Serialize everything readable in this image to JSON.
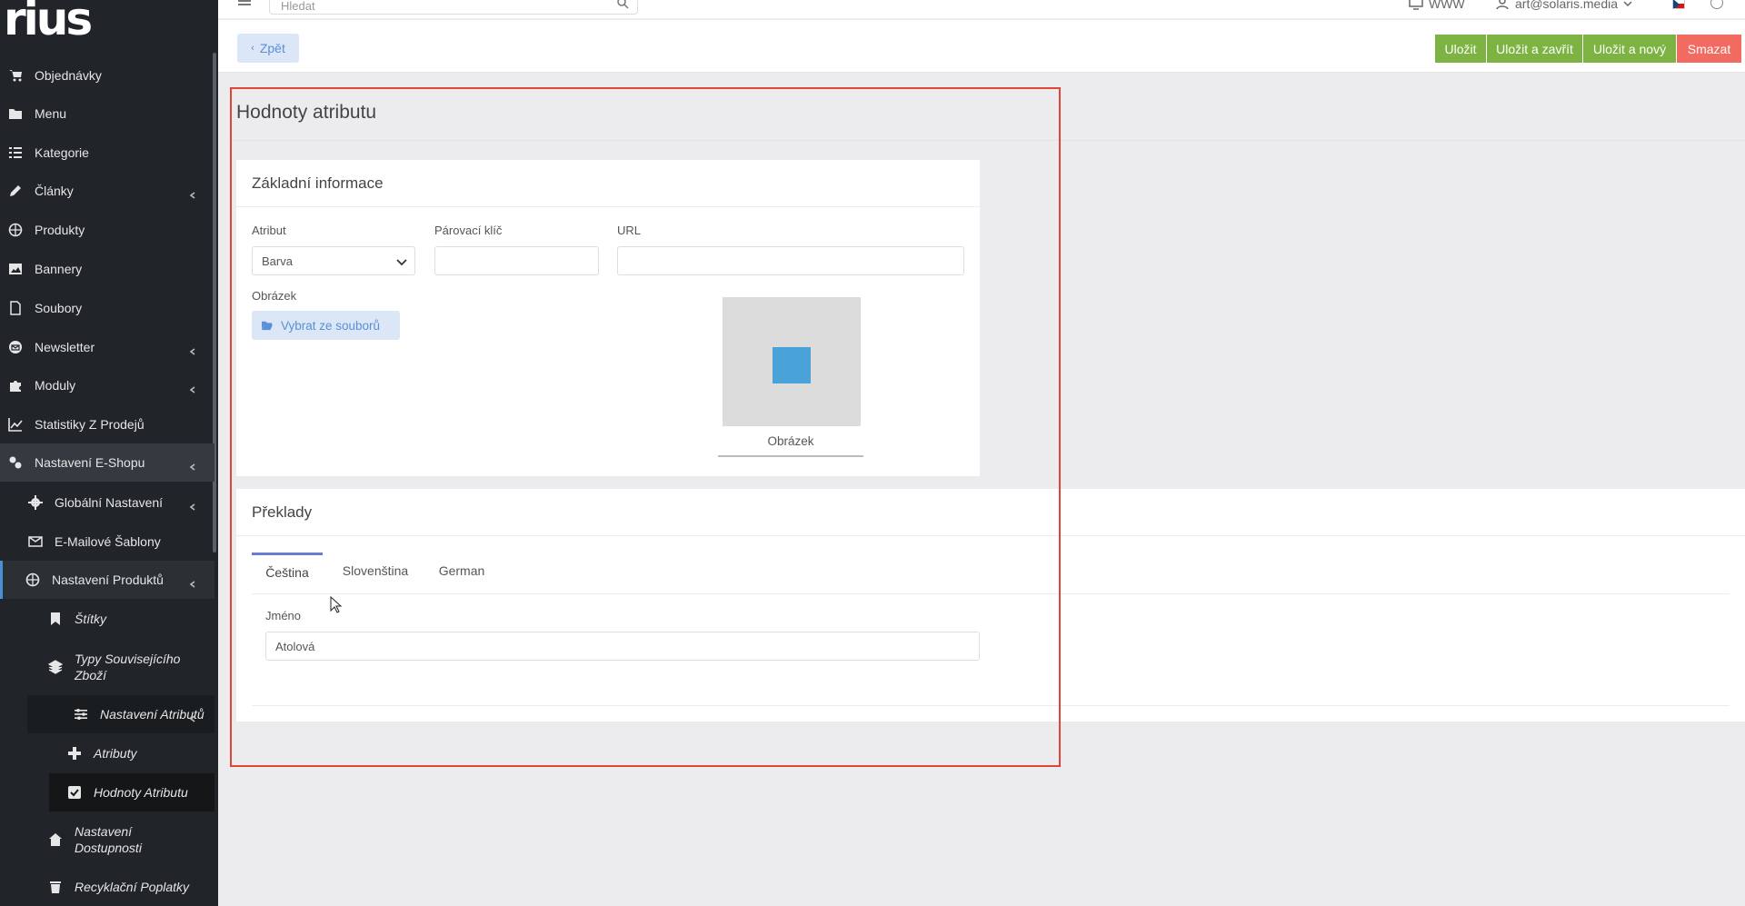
{
  "app": {
    "logo_text": "rius"
  },
  "sidebar": {
    "items": [
      {
        "label": "Objednávky",
        "icon": "cart-icon"
      },
      {
        "label": "Menu",
        "icon": "folder-icon"
      },
      {
        "label": "Kategorie",
        "icon": "list-icon"
      },
      {
        "label": "Články",
        "icon": "pencil-icon"
      },
      {
        "label": "Produkty",
        "icon": "ball-icon"
      },
      {
        "label": "Bannery",
        "icon": "image-icon"
      },
      {
        "label": "Soubory",
        "icon": "file-icon"
      },
      {
        "label": "Newsletter",
        "icon": "envelope-icon"
      },
      {
        "label": "Moduly",
        "icon": "puzzle-icon"
      },
      {
        "label": "Statistiky Z Prodejů",
        "icon": "chart-icon"
      },
      {
        "label": "Nastavení E-Shopu",
        "icon": "cogs-icon"
      },
      {
        "label": "Globální Nastavení",
        "icon": "gear-icon"
      },
      {
        "label": "E-Mailové Šablony",
        "icon": "mail-template-icon"
      },
      {
        "label": "Nastavení Produktů",
        "icon": "ball-icon"
      },
      {
        "label": "Štítky",
        "icon": "bookmark-icon"
      },
      {
        "label": "Typy Souvisejícího Zboží",
        "icon": "layers-icon"
      },
      {
        "label": "Nastavení Atributů",
        "icon": "sliders-icon"
      },
      {
        "label": "Atributy",
        "icon": "plus-icon"
      },
      {
        "label": "Hodnoty Atributu",
        "icon": "checkbox-icon"
      },
      {
        "label": "Nastavení Dostupnosti",
        "icon": "home-icon"
      },
      {
        "label": "Recyklační Poplatky",
        "icon": "trash-icon"
      }
    ]
  },
  "topbar": {
    "search_placeholder": "Hledat",
    "www_label": "WWW",
    "user_email": "art@solaris.media"
  },
  "toolbar": {
    "back_label": "Zpět",
    "save_label": "Uložit",
    "save_close_label": "Uložit a zavřít",
    "save_new_label": "Uložit a nový",
    "delete_label": "Smazat"
  },
  "page": {
    "title": "Hodnoty atributu"
  },
  "basic_info": {
    "heading": "Základní informace",
    "attribute_label": "Atribut",
    "attribute_value": "Barva",
    "pairing_key_label": "Párovací klíč",
    "pairing_key_value": "",
    "url_label": "URL",
    "url_value": "",
    "image_label": "Obrázek",
    "pick_file_label": "Vybrat ze souborů",
    "image_caption": "Obrázek",
    "swatch_color": "#4aa3d8"
  },
  "translations": {
    "heading": "Překlady",
    "tabs": [
      "Čeština",
      "Slovenština",
      "German"
    ],
    "name_label": "Jméno",
    "name_value": "Atolová"
  },
  "colors": {
    "sidebar_bg": "#212529",
    "save_green": "#7cb342",
    "delete_red": "#f26b60",
    "highlight_red": "#e0453a",
    "accent_blue": "#5b8fd6"
  }
}
